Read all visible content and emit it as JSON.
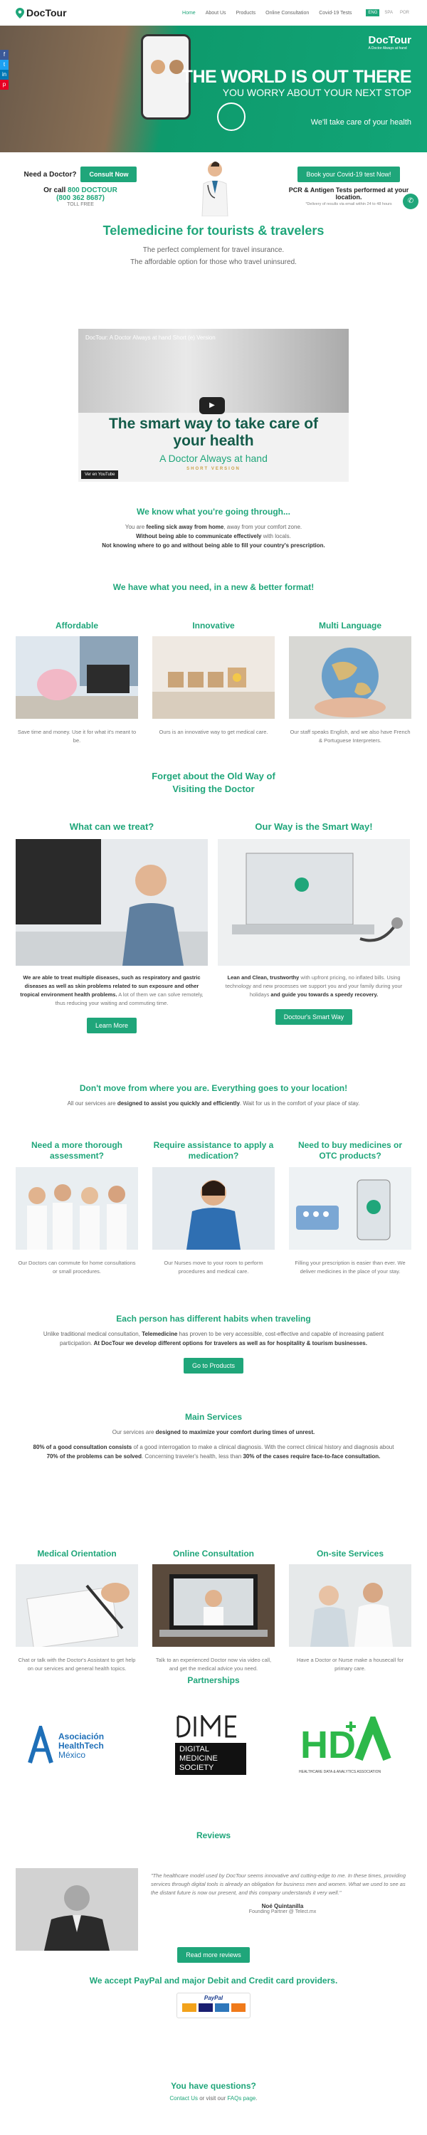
{
  "header": {
    "logo_text": "DocTour",
    "nav": [
      "Home",
      "About Us",
      "Products",
      "Online Consultation",
      "Covid-19 Tests"
    ],
    "languages": [
      "ENG",
      "SPA",
      "POR"
    ]
  },
  "hero": {
    "brand_name": "DocTour",
    "brand_tagline": "A Doctor Always at hand",
    "headline": "THE WORLD IS OUT THERE",
    "subheadline": "YOU WORRY ABOUT YOUR NEXT STOP",
    "tagline": "We'll take care of your health"
  },
  "contact": {
    "need_doctor": "Need a Doctor?",
    "consult_button": "Consult Now",
    "or_call": "Or call",
    "phone": "800 DOCTOUR",
    "phone_number": "(800 362 8687)",
    "toll_free": "TOLL FREE",
    "covid_button": "Book your Covid-19 test Now!",
    "covid_text": "PCR & Antigen Tests performed at your location.",
    "covid_note": "*Delivery of results via email within 24 to 48 hours"
  },
  "telemedicine": {
    "title": "Telemedicine for tourists & travelers",
    "line1": "The perfect complement for travel insurance.",
    "line2": "The affordable option for those who travel uninsured."
  },
  "video": {
    "title": "DocTour: A Doctor Always at hand Short (e) Version",
    "big_text": "The smart way to take care of your health",
    "small_text": "A Doctor Always at hand",
    "short": "SHORT VERSION",
    "youtube": "Ver en YouTube"
  },
  "through": {
    "title": "We know what you're going through...",
    "l1a": "You are ",
    "l1b": "feeling sick away from home",
    "l1c": ", away from your comfort zone.",
    "l2": "Without being able to communicate effectively",
    "l2b": " with locals.",
    "l3": "Not knowing where to go and without being able to fill your country's prescription."
  },
  "format_title": "We have what you need, in a new & better format!",
  "features": [
    {
      "title": "Affordable",
      "text": "Save time and money. Use it for what it's meant to be."
    },
    {
      "title": "Innovative",
      "text": "Ours is an innovative way to get medical care."
    },
    {
      "title": "Multi Language",
      "text": "Our staff speaks English, and we also have French & Portuguese Interpreters."
    }
  ],
  "forget_title": "Forget about the Old Way of Visiting the Doctor",
  "treat": {
    "title": "What can we treat?",
    "text_b": "We are able to treat multiple diseases, such as respiratory and gastric diseases as well as skin problems related to sun exposure and other tropical environment health problems.",
    "text": "A lot of them we can solve remotely, thus reducing your waiting and commuting time.",
    "button": "Learn More"
  },
  "smart": {
    "title": "Our Way is the Smart Way!",
    "text_b": "Lean and Clean, trustworthy",
    "text": " with upfront pricing, no inflated bills. Using technology and new processes we support you and your family during your holidays ",
    "text_b2": "and guide you towards a speedy recovery.",
    "button": "Doctour's Smart Way"
  },
  "dont_move": {
    "title": "Don't move from where you are. Everything goes to your location!",
    "text_a": "All our services are ",
    "text_b": "designed to assist you quickly and efficiently",
    "text_c": ". Wait for us in the comfort of your place of stay."
  },
  "assist": [
    {
      "title": "Need a more thorough assessment?",
      "text": "Our Doctors can commute for home consultations or small procedures."
    },
    {
      "title": "Require assistance to apply a medication?",
      "text": "Our Nurses move to your room to perform procedures and medical care."
    },
    {
      "title": "Need to buy medicines or OTC products?",
      "text": "Filling your prescription is easier than ever. We deliver medicines in the place of your stay."
    }
  ],
  "habits": {
    "title": "Each person has different habits when traveling",
    "text_a": "Unlike traditional medical consultation, ",
    "text_b": "Telemedicine",
    "text_c": " has proven to be very accessible, cost-effective and capable of increasing patient participation. ",
    "text_d": "At DocTour we develop different options for travelers as well as for hospitality & tourism businesses.",
    "button": "Go to Products"
  },
  "main_services": {
    "title": "Main Services",
    "l1a": "Our services are ",
    "l1b": "designed to maximize your comfort during times of unrest.",
    "l2a": "80% of a good consultation consists",
    "l2b": " of a good interrogation to make a clinical diagnosis. With the correct clinical history and diagnosis about ",
    "l2c": "70% of the problems can be solved",
    "l2d": ". Concerning traveler's health, less than ",
    "l2e": "30% of the cases require face-to-face consultation."
  },
  "services": [
    {
      "title": "Medical Orientation",
      "text": "Chat or talk with the Doctor's Assistant to get help on our services and general health topics."
    },
    {
      "title": "Online Consultation",
      "text": "Talk to an experienced Doctor now via video call, and get the medical advice you need."
    },
    {
      "title": "On-site Services",
      "text": "Have a Doctor or Nurse make a housecall for primary care."
    }
  ],
  "partnerships": {
    "title": "Partnerships",
    "p1_a": "Asociación",
    "p1_b": "HealthTech",
    "p1_c": "México",
    "p2_a": "DIGITAL",
    "p2_b": "MEDICINE",
    "p2_c": "SOCIETY",
    "p3": "HEALTHCARE DATA & ANALYTICS ASSOCIATION"
  },
  "reviews": {
    "title": "Reviews",
    "quote": "\"The healthcare model used by DocTour seems innovative and cutting-edge to me. In these times, providing services through digital tools is already an obligation for business men and women. What we used to see as the distant future is now our present, and this company understands it very well.\"",
    "name": "Noé Quintanilla",
    "role": "Founding Partner @ Telect.mx",
    "button": "Read more reviews"
  },
  "payments": {
    "title": "We accept PayPal and major Debit and Credit card providers.",
    "paypal": "PayPal"
  },
  "questions": {
    "title": "You have questions?",
    "a": "Contact Us",
    "b": " or visit our ",
    "c": "FAQs page",
    "d": "."
  },
  "colors": {
    "accent": "#1fa67a",
    "dark_green": "#145c4a"
  }
}
